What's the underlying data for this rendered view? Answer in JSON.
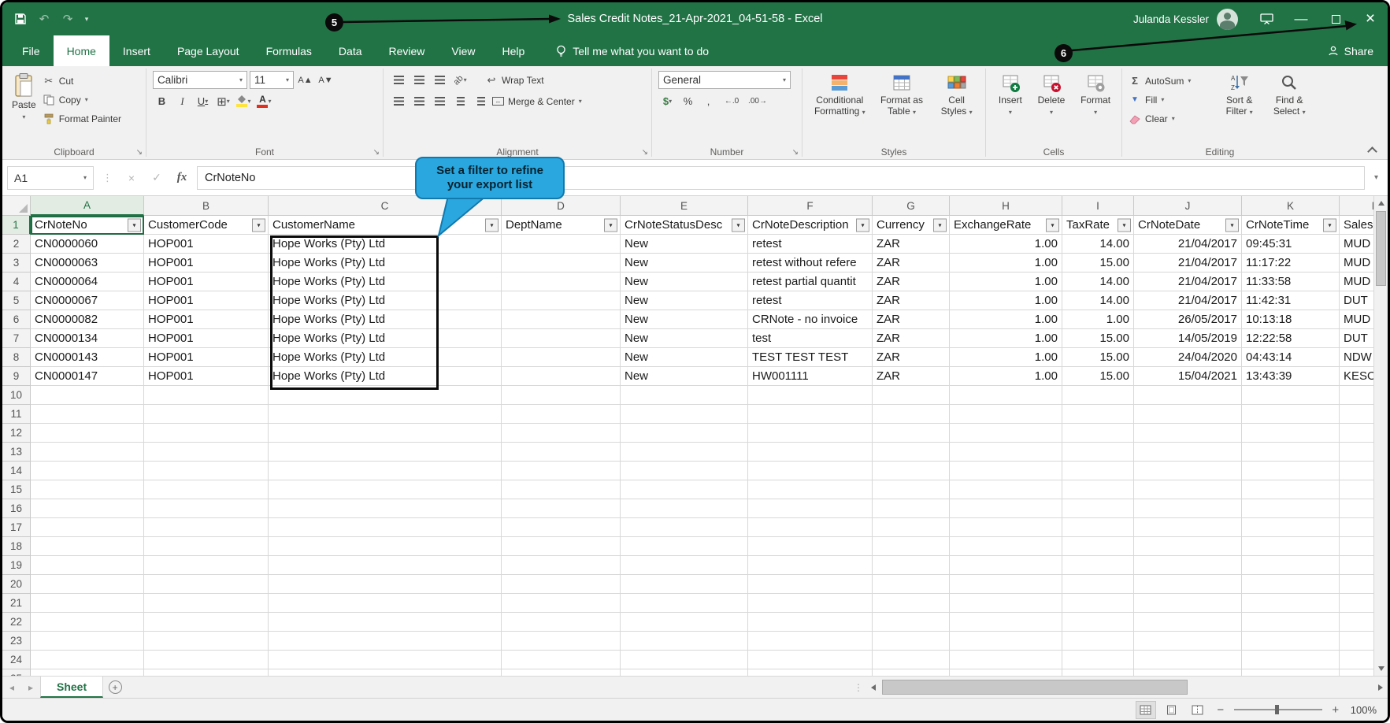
{
  "titlebar": {
    "title": "Sales Credit Notes_21-Apr-2021_04-51-58  -  Excel",
    "user_name": "Julanda Kessler"
  },
  "ribbon_tabs": {
    "items": [
      "File",
      "Home",
      "Insert",
      "Page Layout",
      "Formulas",
      "Data",
      "Review",
      "View",
      "Help"
    ],
    "active": "Home",
    "tell_me": "Tell me what you want to do",
    "share": "Share"
  },
  "ribbon": {
    "clipboard": {
      "group_label": "Clipboard",
      "paste": "Paste",
      "cut": "Cut",
      "copy": "Copy",
      "format_painter": "Format Painter"
    },
    "font": {
      "group_label": "Font",
      "font_name": "Calibri",
      "font_size": "11"
    },
    "alignment": {
      "group_label": "Alignment",
      "wrap_text": "Wrap Text",
      "merge_center": "Merge & Center"
    },
    "number": {
      "group_label": "Number",
      "number_format": "General"
    },
    "styles": {
      "group_label": "Styles",
      "conditional": "Conditional Formatting",
      "format_table": "Format as Table",
      "cell_styles": "Cell Styles"
    },
    "cells": {
      "group_label": "Cells",
      "insert": "Insert",
      "delete": "Delete",
      "format": "Format"
    },
    "editing": {
      "group_label": "Editing",
      "autosum": "AutoSum",
      "fill": "Fill",
      "clear": "Clear",
      "sort_filter": "Sort & Filter",
      "find_select": "Find & Select"
    }
  },
  "formula_bar": {
    "name_box": "A1",
    "formula": "CrNoteNo"
  },
  "grid": {
    "column_letters": [
      "A",
      "B",
      "C",
      "D",
      "E",
      "F",
      "G",
      "H",
      "I",
      "J",
      "K",
      "L"
    ],
    "header_row": [
      "CrNoteNo",
      "CustomerCode",
      "CustomerName",
      "DeptName",
      "CrNoteStatusDesc",
      "CrNoteDescription",
      "Currency",
      "ExchangeRate",
      "TaxRate",
      "CrNoteDate",
      "CrNoteTime",
      "Sales"
    ],
    "data_rows": [
      [
        "CN0000060",
        "HOP001",
        "Hope Works (Pty) Ltd",
        "",
        "New",
        "retest",
        "ZAR",
        "1.00",
        "14.00",
        "21/04/2017",
        "09:45:31",
        "MUD"
      ],
      [
        "CN0000063",
        "HOP001",
        "Hope Works (Pty) Ltd",
        "",
        "New",
        "retest without refere",
        "ZAR",
        "1.00",
        "15.00",
        "21/04/2017",
        "11:17:22",
        "MUD"
      ],
      [
        "CN0000064",
        "HOP001",
        "Hope Works (Pty) Ltd",
        "",
        "New",
        "retest partial quantit",
        "ZAR",
        "1.00",
        "14.00",
        "21/04/2017",
        "11:33:58",
        "MUD"
      ],
      [
        "CN0000067",
        "HOP001",
        "Hope Works (Pty) Ltd",
        "",
        "New",
        "retest",
        "ZAR",
        "1.00",
        "14.00",
        "21/04/2017",
        "11:42:31",
        "DUT"
      ],
      [
        "CN0000082",
        "HOP001",
        "Hope Works (Pty) Ltd",
        "",
        "New",
        "CRNote - no invoice",
        "ZAR",
        "1.00",
        "1.00",
        "26/05/2017",
        "10:13:18",
        "MUD"
      ],
      [
        "CN0000134",
        "HOP001",
        "Hope Works (Pty) Ltd",
        "",
        "New",
        "test",
        "ZAR",
        "1.00",
        "15.00",
        "14/05/2019",
        "12:22:58",
        "DUT"
      ],
      [
        "CN0000143",
        "HOP001",
        "Hope Works (Pty) Ltd",
        "",
        "New",
        "TEST TEST TEST",
        "ZAR",
        "1.00",
        "15.00",
        "24/04/2020",
        "04:43:14",
        "NDW"
      ],
      [
        "CN0000147",
        "HOP001",
        "Hope Works (Pty) Ltd",
        "",
        "New",
        "HW001111",
        "ZAR",
        "1.00",
        "15.00",
        "15/04/2021",
        "13:43:39",
        "KESO"
      ]
    ],
    "total_rows": 25
  },
  "sheet_bar": {
    "sheet_name": "Sheet"
  },
  "status_bar": {
    "zoom_level": "100%"
  },
  "annotations": {
    "step_5": "5",
    "step_6": "6",
    "bubble_text": "Set a filter to refine your export list"
  },
  "colors": {
    "accent_green": "#217346",
    "bubble_blue": "#2BA7E0",
    "annotation_black": "#0a0a0a"
  },
  "icons": {
    "dropdown": "▾",
    "undo": "↶",
    "redo": "↷",
    "qat_more": "▾",
    "minimize": "—",
    "close": "×",
    "cut": "✂",
    "check": "✓",
    "cancel": "×",
    "fx": "fx",
    "autosum": "Σ",
    "percent": "%",
    "comma": ",",
    "borders": "⊞",
    "launcher": "↘",
    "prev": "◂",
    "next": "▸",
    "plus": "+",
    "minus": "−",
    "grip": "⋮",
    "bold": "B",
    "italic": "I",
    "underline": "U",
    "font_color_letter": "A",
    "increase_font": "A▲",
    "decrease_font": "A▼",
    "orientation": "ab",
    "wrap_return": "↩",
    "merge_arrows": "↔",
    "currency": "$",
    "inc_decimal": "←.0",
    "dec_decimal": ".00→",
    "fill_arrow": "▼"
  }
}
